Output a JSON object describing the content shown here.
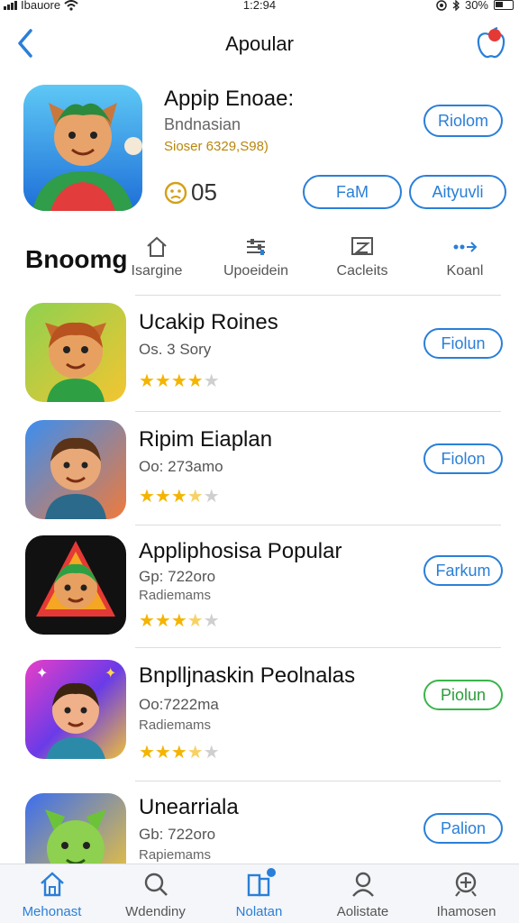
{
  "status_bar": {
    "carrier": "Ibauore",
    "time": "1:2:94",
    "battery": "30%"
  },
  "nav": {
    "title": "Apoular"
  },
  "featured": {
    "title": "Appip Enoae:",
    "subtitle": "Bndnasian",
    "meta": "Sioser 6329,S98)",
    "rating": "05",
    "get_label": "Riolom",
    "button1": "FaM",
    "button2": "Aityuvli"
  },
  "section": {
    "title": "Bnoomg",
    "categories": [
      {
        "label": "Isargine",
        "icon": "house-icon"
      },
      {
        "label": "Upoeidein",
        "icon": "sliders-icon"
      },
      {
        "label": "Cacleits",
        "icon": "image-icon"
      },
      {
        "label": "Koanl",
        "icon": "dots-arrow-icon"
      }
    ]
  },
  "apps": [
    {
      "name": "Ucakip Roines",
      "sub": "Os. 3 Sory",
      "sub2": "",
      "stars": 4,
      "action": "Fiolun",
      "accent": "#2a7fd8"
    },
    {
      "name": "Ripim Eiaplan",
      "sub": "Oo: 273amo",
      "sub2": "",
      "stars": 3.5,
      "action": "Fiolon",
      "accent": "#2a7fd8"
    },
    {
      "name": "Appliphosisa Popular",
      "sub": "Gp: 722oro",
      "sub2": "Radiemams",
      "stars": 3.5,
      "action": "Farkum",
      "accent": "#2a7fd8"
    },
    {
      "name": "Bnplljnaskin Peolnalas",
      "sub": "Oo:7222ma",
      "sub2": "Radiemams",
      "stars": 3.5,
      "action": "Piolun",
      "accent": "#3bb54a"
    },
    {
      "name": "Unearriala",
      "sub": "Gb: 722oro",
      "sub2": "Rapiemams",
      "stars": 0,
      "action": "Palion",
      "accent": "#2a7fd8"
    }
  ],
  "tabs": [
    {
      "label": "Mehonast",
      "icon": "home-icon",
      "active": true
    },
    {
      "label": "Wdendiny",
      "icon": "search-icon",
      "active": false
    },
    {
      "label": "Nolatan",
      "icon": "apps-icon",
      "active": true
    },
    {
      "label": "Aolistate",
      "icon": "person-icon",
      "active": false
    },
    {
      "label": "Ihamosen",
      "icon": "search-plus-icon",
      "active": false
    }
  ]
}
